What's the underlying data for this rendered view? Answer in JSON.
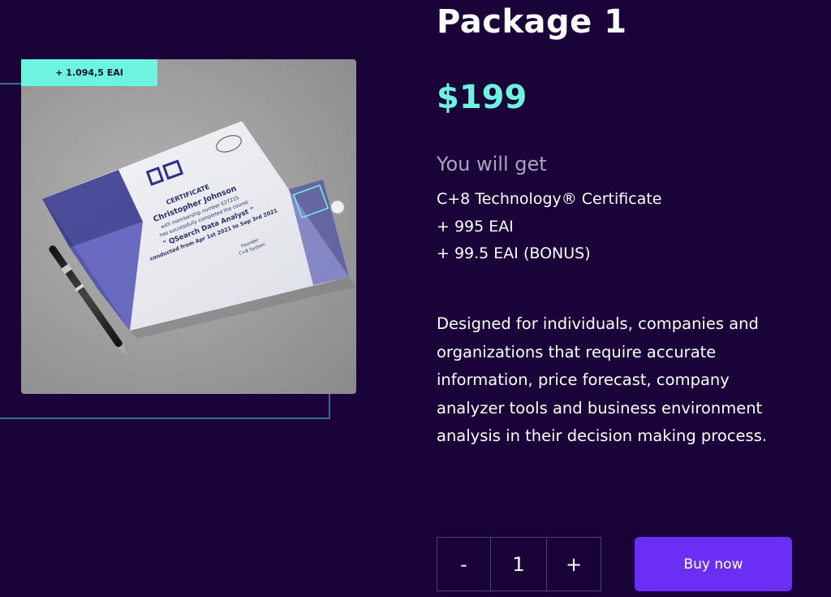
{
  "package": {
    "title": "Package 1",
    "price": "$199",
    "you_will_get": "You will get",
    "benefits": [
      "C+8 Technology® Certificate",
      "+ 995 EAI",
      "+ 99.5 EAI (BONUS)"
    ],
    "description": "Designed for individuals, companies and organizations that require accurate information, price forecast, company analyzer tools and business environment analysis in their decision making process."
  },
  "image": {
    "badge": "+ 1.094,5 EAI",
    "certificate": {
      "heading": "CERTIFICATE",
      "name": "Christopher Johnson",
      "line1": "with membership number E2721S",
      "line2": "has successfully completed the course",
      "course": "\" QSearch Data Analyst \"",
      "dates": "conducted from Apr 1st 2021 to Sep 3rd 2021",
      "signer_role": "Founder",
      "signer_org": "C+8 System"
    }
  },
  "quantity": {
    "minus": "-",
    "value": "1",
    "plus": "+"
  },
  "buy": {
    "label": "Buy now"
  },
  "colors": {
    "background": "#190339",
    "accent": "#6ff3e1",
    "button": "#6a2ef5"
  }
}
